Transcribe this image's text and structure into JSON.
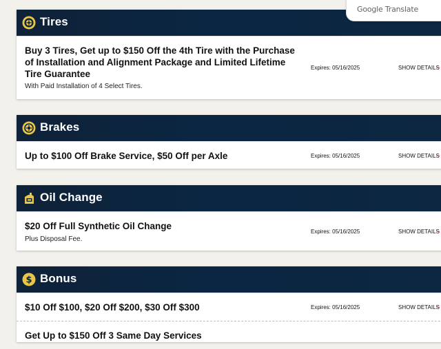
{
  "translate_badge": {
    "label": "Google Translate"
  },
  "sections": [
    {
      "title": "Tires",
      "icon": "tire-icon",
      "offers": [
        {
          "title": "Buy 3 Tires, Get up to $150 Off the 4th Tire with the Purchase of Installation and Alignment Package and Limited Lifetime Tire Guarantee",
          "subtitle": "With Paid Installation of 4 Select Tires.",
          "expires": "Expires: 05/16/2025",
          "details": "SHOW DETAILS"
        }
      ]
    },
    {
      "title": "Brakes",
      "icon": "brake-icon",
      "offers": [
        {
          "title": "Up to $100 Off Brake Service, $50 Off per Axle",
          "expires": "Expires: 05/16/2025",
          "details": "SHOW DETAILS"
        }
      ]
    },
    {
      "title": "Oil Change",
      "icon": "oil-bottle-icon",
      "offers": [
        {
          "title": "$20 Off Full Synthetic Oil Change",
          "subtitle": "Plus Disposal Fee.",
          "expires": "Expires: 05/16/2025",
          "details": "SHOW DETAILS"
        }
      ]
    },
    {
      "title": "Bonus",
      "icon": "dollar-coin-icon",
      "offers": [
        {
          "title": "$10 Off $100, $20 Off $200, $30 Off $300",
          "expires": "Expires: 05/16/2025",
          "details": "SHOW DETAILS"
        },
        {
          "title": "Get Up to $150 Off 3 Same Day Services"
        }
      ]
    }
  ],
  "colors": {
    "header_bg": "#0b2440",
    "icon_gold": "#e9c645",
    "arrow_red": "#d62828",
    "page_bg": "#f3f1ec"
  }
}
